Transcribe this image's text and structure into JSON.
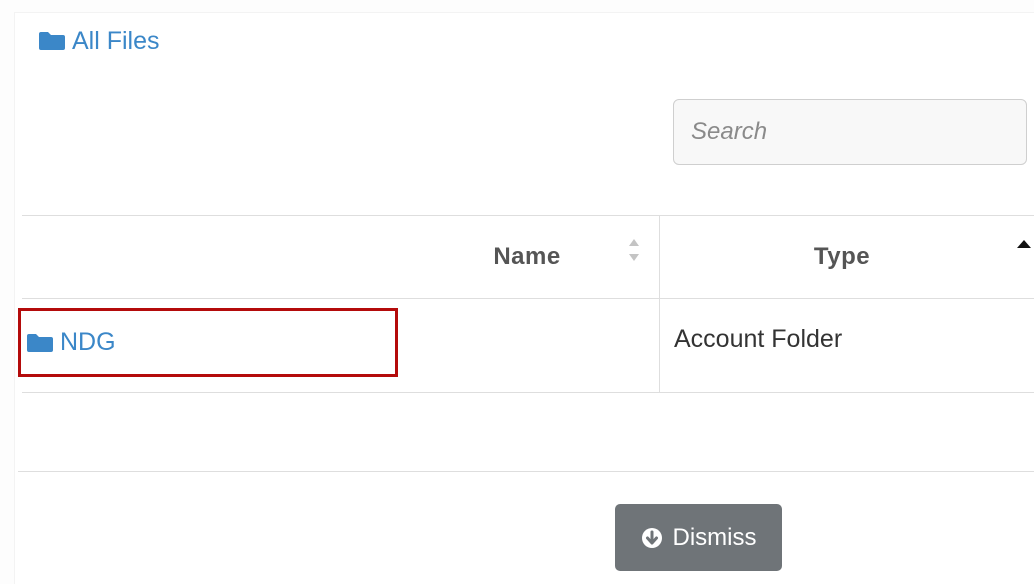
{
  "breadcrumb": {
    "label": "All Files",
    "icon": "folder-icon"
  },
  "search": {
    "placeholder": "Search",
    "value": ""
  },
  "table": {
    "columns": [
      {
        "label": "Name",
        "sort": "unsorted"
      },
      {
        "label": "Type",
        "sort": "ascending"
      }
    ],
    "rows": [
      {
        "name": "NDG",
        "type": "Account Folder",
        "icon": "folder-icon"
      }
    ]
  },
  "footer": {
    "dismiss_label": "Dismiss",
    "dismiss_icon": "circle-arrow-down-icon"
  },
  "colors": {
    "link": "#3b87c8",
    "highlight_border": "#b40b0b",
    "dismiss_button": "#6f7478"
  }
}
